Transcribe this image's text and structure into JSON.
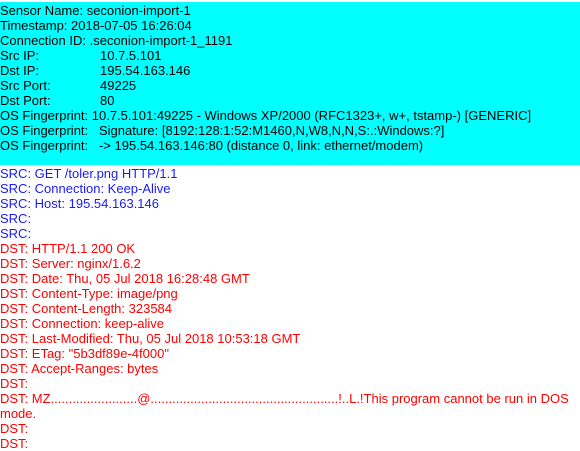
{
  "header": {
    "sensor_name": "Sensor Name: seconion-import-1",
    "timestamp": "Timestamp: 2018-07-05 16:26:04",
    "connection_id": "Connection ID: .seconion-import-1_1191",
    "fields": [
      {
        "label": "Src IP:",
        "value": "10.7.5.101"
      },
      {
        "label": "Dst IP:",
        "value": "195.54.163.146"
      },
      {
        "label": "Src Port:",
        "value": "49225"
      },
      {
        "label": "Dst Port:",
        "value": "80"
      }
    ],
    "fingerprints": [
      "OS Fingerprint: 10.7.5.101:49225 - Windows XP/2000 (RFC1323+, w+, tstamp-) [GENERIC]",
      "OS Fingerprint:   Signature: [8192:128:1:52:M1460,N,W8,N,N,S:.:Windows:?]",
      "OS Fingerprint:   -> 195.54.163.146:80 (distance 0, link: ethernet/modem)"
    ],
    "colors": {
      "background": "#00ffff"
    }
  },
  "transcript": {
    "colors": {
      "src": "#1a1aff",
      "dst": "#ff0000"
    },
    "src_lines": [
      "SRC: GET /toler.png HTTP/1.1",
      "SRC: Connection: Keep-Alive",
      "SRC: Host: 195.54.163.146",
      "SRC:",
      "SRC:"
    ],
    "dst_lines": [
      "DST: HTTP/1.1 200 OK",
      "DST: Server: nginx/1.6.2",
      "DST: Date: Thu, 05 Jul 2018 16:28:48 GMT",
      "DST: Content-Type: image/png",
      "DST: Content-Length: 323584",
      "DST: Connection: keep-alive",
      "DST: Last-Modified: Thu, 05 Jul 2018 10:53:18 GMT",
      "DST: ETag: \"5b3df89e-4f000\"",
      "DST: Accept-Ranges: bytes",
      "DST:",
      "DST: MZ........................@....................................................!..L.!This program cannot be run in DOS mode.",
      "DST:",
      "DST:"
    ]
  }
}
